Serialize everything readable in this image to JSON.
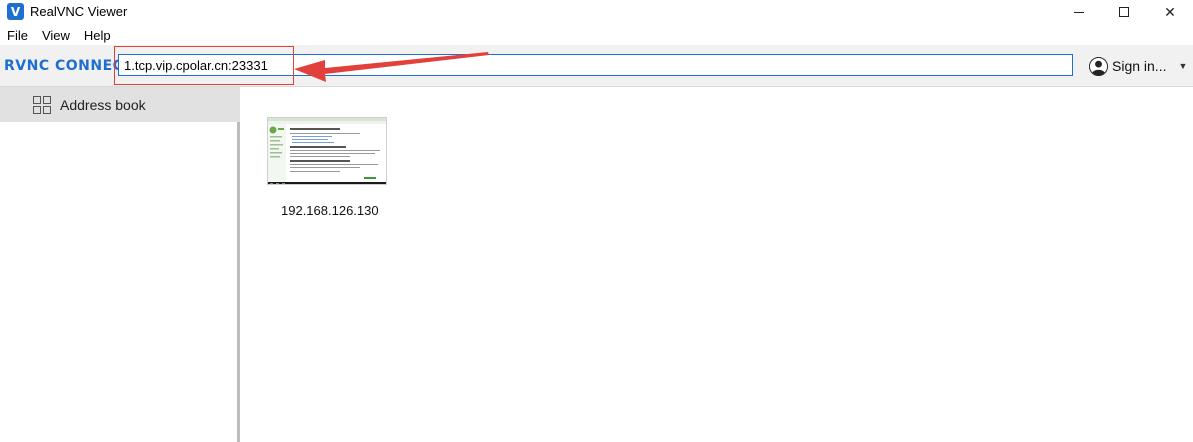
{
  "window": {
    "title": "RealVNC Viewer",
    "minimize_glyph": "minimize-icon",
    "maximize_glyph": "maximize-icon",
    "close_glyph": "✕"
  },
  "menu": [
    "File",
    "View",
    "Help"
  ],
  "toolbar": {
    "brand": "RVNC CONNECT",
    "address_value": "1.tcp.vip.cpolar.cn:23331",
    "signin_label": "Sign in...",
    "caret": "▼"
  },
  "sidebar": {
    "items": [
      {
        "label": "Address book",
        "icon": "grid-icon"
      }
    ]
  },
  "main": {
    "connections": [
      {
        "label": "192.168.126.130",
        "icon": "desktop-thumbnail"
      }
    ]
  },
  "colors": {
    "accent": "#1e6fd0",
    "annotation": "#e2413b",
    "toolbar_bg": "#f1f1f1",
    "sidebar_selected": "#e1e1e1"
  }
}
